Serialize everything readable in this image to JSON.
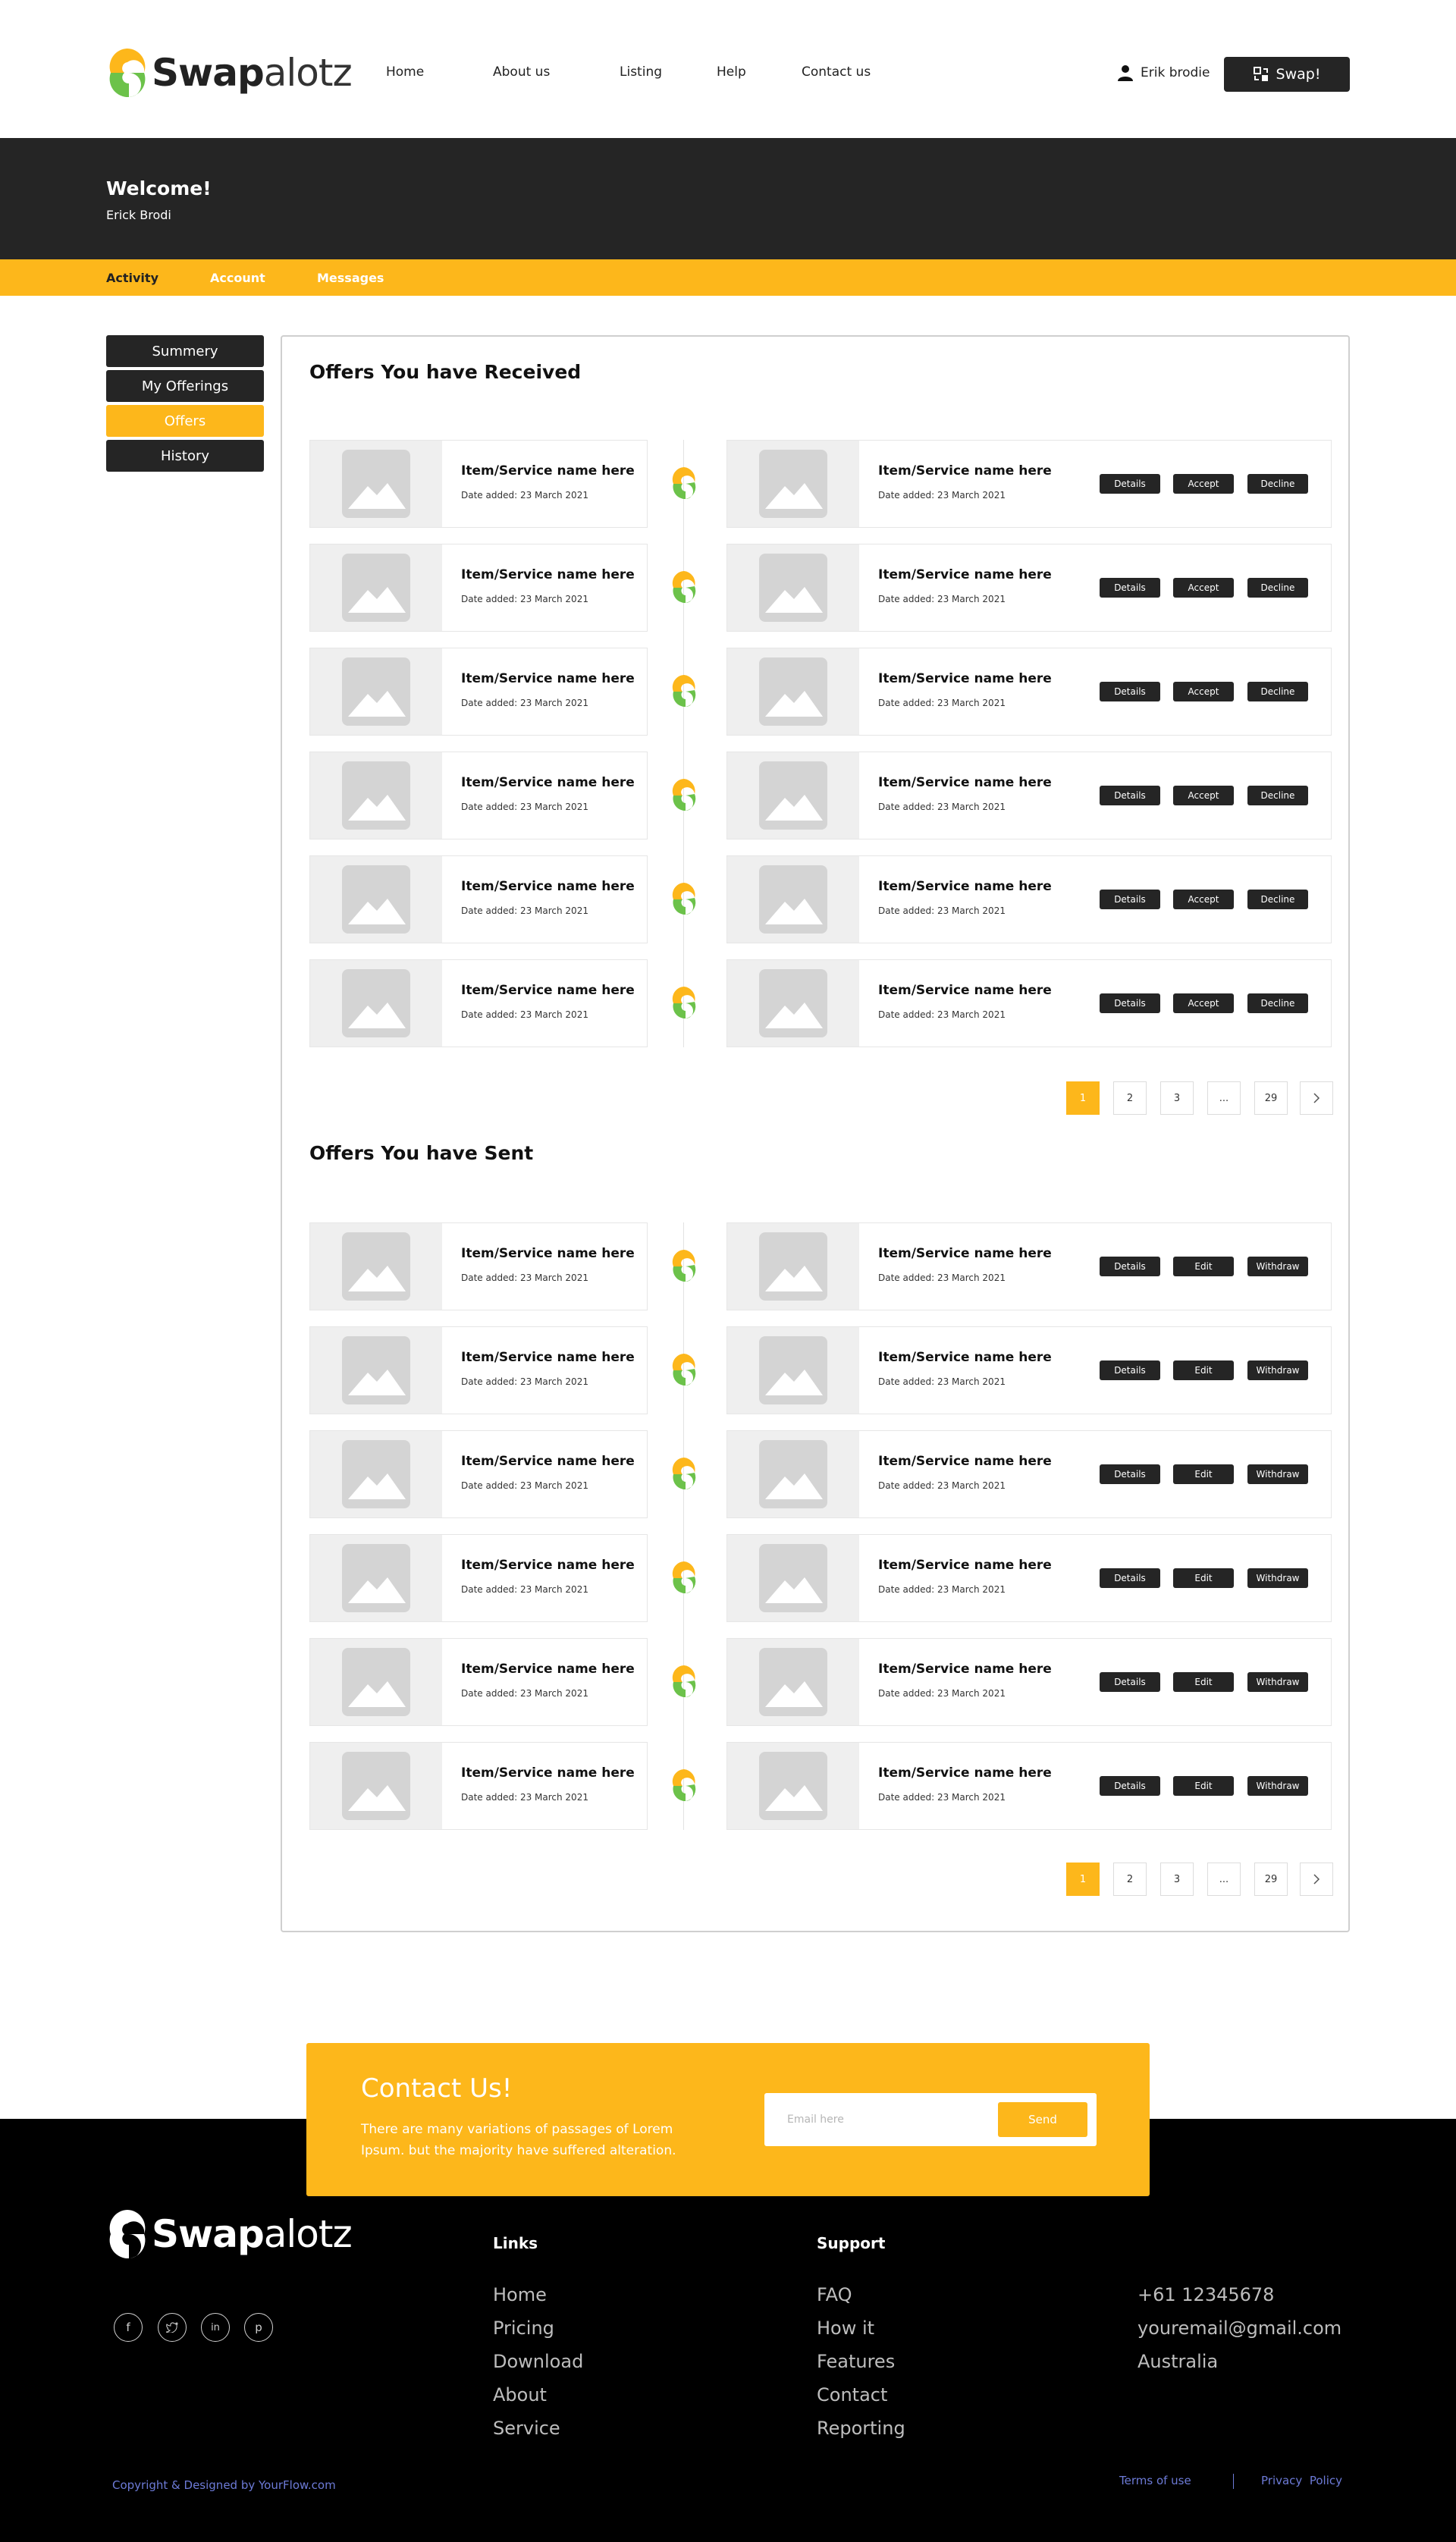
{
  "brand": {
    "strong": "Swap",
    "light": "alotz",
    "colors": {
      "accent": "#FDB71B",
      "green": "#6CC24A",
      "dark": "#252525"
    }
  },
  "nav": {
    "items": [
      "Home",
      "About us",
      "Listing",
      "Help",
      "Contact us"
    ]
  },
  "user": {
    "name": "Erik brodie",
    "icon": "user-icon"
  },
  "header": {
    "swap_button": "Swap!",
    "swap_icon": "swap-icon"
  },
  "banner": {
    "title": "Welcome!",
    "subtitle": "Erick Brodi"
  },
  "tabs": [
    "Activity",
    "Account",
    "Messages"
  ],
  "sidebar": {
    "items": [
      "Summery",
      "My Offerings",
      "Offers",
      "History"
    ],
    "active": "Offers"
  },
  "received": {
    "title": "Offers You have Received",
    "actions": [
      "Details",
      "Accept",
      "Decline"
    ],
    "rows": [
      {
        "left_name": "Item/Service name here",
        "left_date": "Date added: 23 March 2021",
        "right_name": "Item/Service name here",
        "right_date": "Date added: 23 March 2021"
      },
      {
        "left_name": "Item/Service name here",
        "left_date": "Date added: 23 March 2021",
        "right_name": "Item/Service name here",
        "right_date": "Date added: 23 March 2021"
      },
      {
        "left_name": "Item/Service name here",
        "left_date": "Date added: 23 March 2021",
        "right_name": "Item/Service name here",
        "right_date": "Date added: 23 March 2021"
      },
      {
        "left_name": "Item/Service name here",
        "left_date": "Date added: 23 March 2021",
        "right_name": "Item/Service name here",
        "right_date": "Date added: 23 March 2021"
      },
      {
        "left_name": "Item/Service name here",
        "left_date": "Date added: 23 March 2021",
        "right_name": "Item/Service name here",
        "right_date": "Date added: 23 March 2021"
      },
      {
        "left_name": "Item/Service name here",
        "left_date": "Date added: 23 March 2021",
        "right_name": "Item/Service name here",
        "right_date": "Date added: 23 March 2021"
      }
    ],
    "pagination": [
      "1",
      "2",
      "3",
      "...",
      "29"
    ],
    "current_page": "1"
  },
  "sent": {
    "title": "Offers You have Sent",
    "actions": [
      "Details",
      "Edit",
      "Withdraw"
    ],
    "rows": [
      {
        "left_name": "Item/Service name here",
        "left_date": "Date added: 23 March 2021",
        "right_name": "Item/Service name here",
        "right_date": "Date added: 23 March 2021"
      },
      {
        "left_name": "Item/Service name here",
        "left_date": "Date added: 23 March 2021",
        "right_name": "Item/Service name here",
        "right_date": "Date added: 23 March 2021"
      },
      {
        "left_name": "Item/Service name here",
        "left_date": "Date added: 23 March 2021",
        "right_name": "Item/Service name here",
        "right_date": "Date added: 23 March 2021"
      },
      {
        "left_name": "Item/Service name here",
        "left_date": "Date added: 23 March 2021",
        "right_name": "Item/Service name here",
        "right_date": "Date added: 23 March 2021"
      },
      {
        "left_name": "Item/Service name here",
        "left_date": "Date added: 23 March 2021",
        "right_name": "Item/Service name here",
        "right_date": "Date added: 23 March 2021"
      },
      {
        "left_name": "Item/Service name here",
        "left_date": "Date added: 23 March 2021",
        "right_name": "Item/Service name here",
        "right_date": "Date added: 23 March 2021"
      }
    ],
    "pagination": [
      "1",
      "2",
      "3",
      "...",
      "29"
    ],
    "current_page": "1"
  },
  "contact": {
    "title": "Contact Us!",
    "text": "There are many variations of passages of Lorem Ipsum. but the majority have suffered alteration.",
    "email_placeholder": "Email here",
    "send_label": "Send"
  },
  "footer": {
    "social": [
      "facebook-icon",
      "twitter-icon",
      "linkedin-icon",
      "pinterest-icon"
    ],
    "links_title": "Links",
    "links": [
      "Home",
      "Pricing",
      "Download",
      "About",
      "Service"
    ],
    "support_title": "Support",
    "support": [
      "FAQ",
      "How it",
      "Features",
      "Contact",
      "Reporting"
    ],
    "contact_info": [
      "+61 12345678",
      "youremail@gmail.com",
      "Australia"
    ],
    "copyright": "Copyright & Designed by YourFlow.com",
    "terms": "Terms of use",
    "privacy": "Privacy  Policy"
  }
}
